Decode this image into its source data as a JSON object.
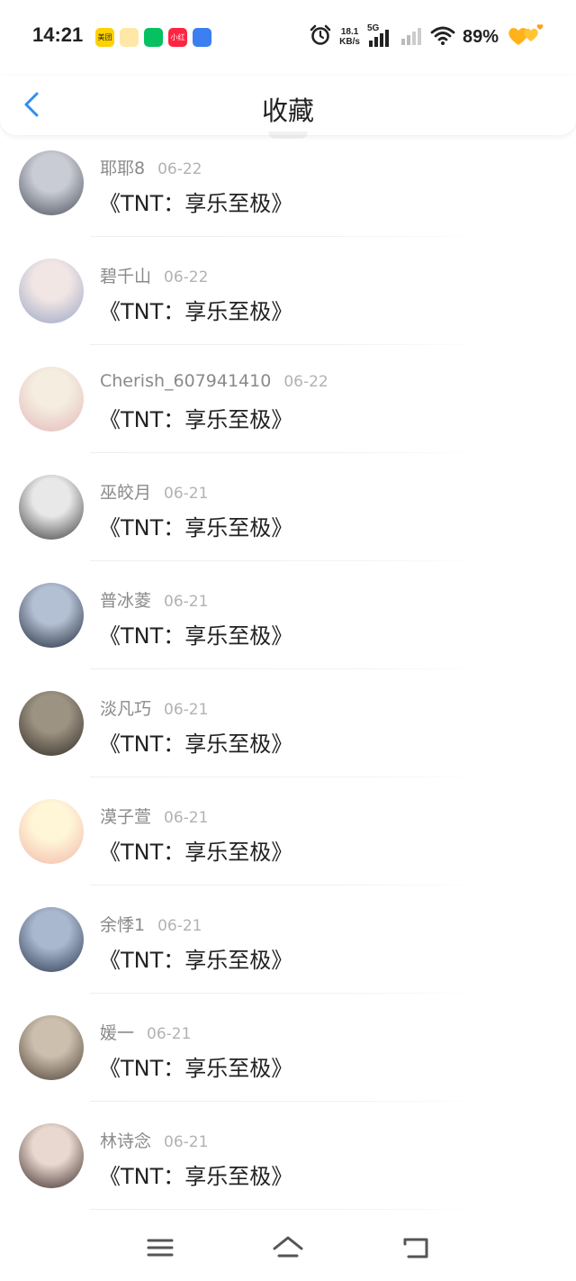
{
  "status_bar": {
    "time": "14:21",
    "app_icons": [
      {
        "name": "meituan-icon",
        "text": "美团",
        "color": "#ffd100",
        "fg": "#222"
      },
      {
        "name": "weibo-icon",
        "text": "",
        "color": "#ffe7a8",
        "fg": "#e6162d"
      },
      {
        "name": "wechat-icon",
        "text": "",
        "color": "#07c160",
        "fg": "#fff"
      },
      {
        "name": "xiaohongshu-icon",
        "text": "小红书",
        "color": "#ff2442",
        "fg": "#fff"
      },
      {
        "name": "browser-icon",
        "text": "",
        "color": "#3b7ff0",
        "fg": "#fff"
      }
    ],
    "net_speed_value": "18.1",
    "net_speed_unit": "KB/s",
    "network_type": "5G",
    "battery": "89%"
  },
  "header": {
    "title": "收藏"
  },
  "favorites": [
    {
      "user": "耶耶8",
      "date": "06-22",
      "title": "《TNT：享乐至极》",
      "avatar": [
        "#c9ccd4",
        "#4a4f5c"
      ]
    },
    {
      "user": "碧千山",
      "date": "06-22",
      "title": "《TNT：享乐至极》",
      "avatar": [
        "#f1e6e4",
        "#9aa4c6"
      ]
    },
    {
      "user": "Cherish_607941410",
      "date": "06-22",
      "title": "《TNT：享乐至极》",
      "avatar": [
        "#f4ede0",
        "#e4b8b8"
      ]
    },
    {
      "user": "巫皎月",
      "date": "06-21",
      "title": "《TNT：享乐至极》",
      "avatar": [
        "#e8e8e8",
        "#3a3a3a"
      ]
    },
    {
      "user": "普冰菱",
      "date": "06-21",
      "title": "《TNT：享乐至极》",
      "avatar": [
        "#b3bfd2",
        "#1f2a3a"
      ]
    },
    {
      "user": "淡凡巧",
      "date": "06-21",
      "title": "《TNT：享乐至极》",
      "avatar": [
        "#9d9382",
        "#2f2a24"
      ]
    },
    {
      "user": "漠子萱",
      "date": "06-21",
      "title": "《TNT：享乐至极》",
      "avatar": [
        "#fff6d8",
        "#f2b8a8"
      ]
    },
    {
      "user": "余悸1",
      "date": "06-21",
      "title": "《TNT：享乐至极》",
      "avatar": [
        "#a9b8cf",
        "#2b3950"
      ]
    },
    {
      "user": "媛一",
      "date": "06-21",
      "title": "《TNT：享乐至极》",
      "avatar": [
        "#cdbfae",
        "#4b3f34"
      ]
    },
    {
      "user": "林诗念",
      "date": "06-21",
      "title": "《TNT：享乐至极》",
      "avatar": [
        "#e9d8cf",
        "#3a2a28"
      ]
    }
  ],
  "nav": {
    "icons": [
      "menu-icon",
      "home-icon",
      "back-nav-icon"
    ]
  }
}
